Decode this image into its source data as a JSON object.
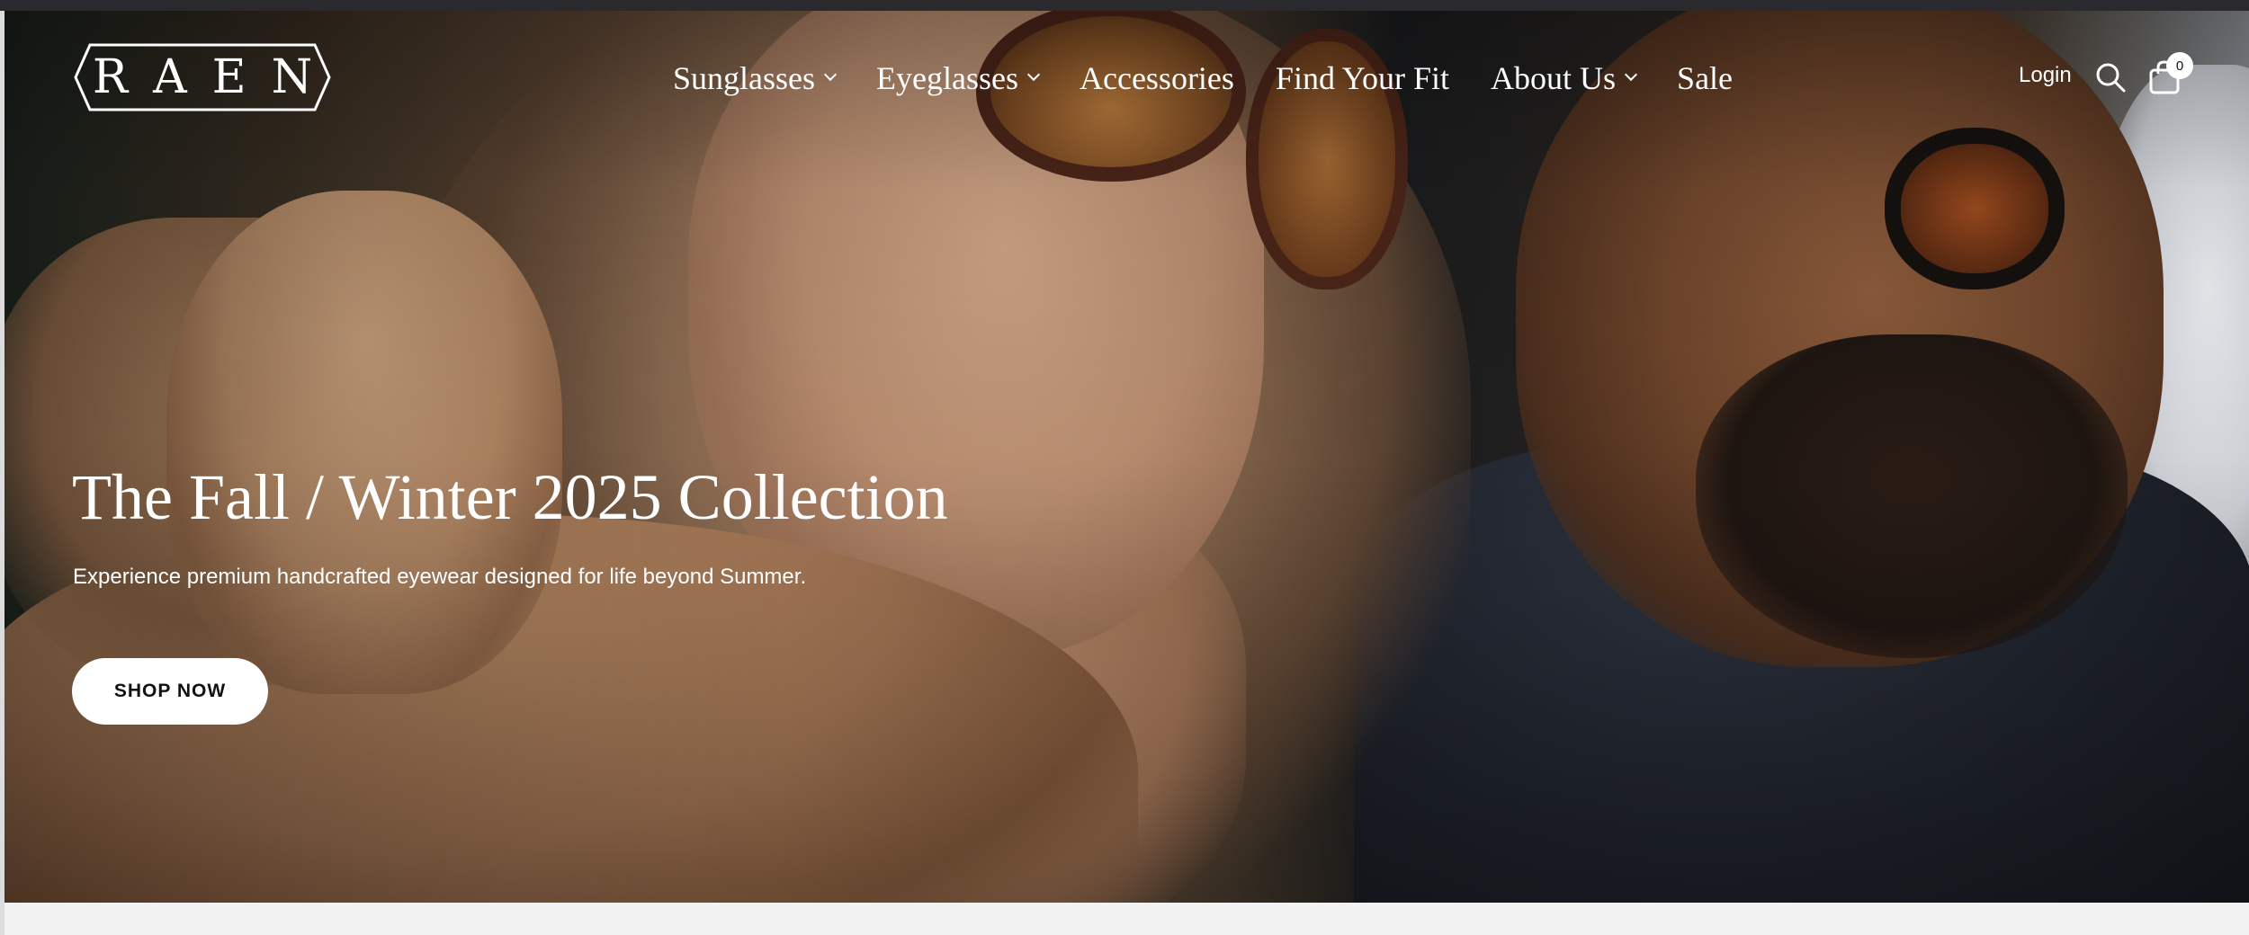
{
  "header": {
    "logo_text": "RAEN",
    "nav": [
      {
        "label": "Sunglasses",
        "has_dropdown": true
      },
      {
        "label": "Eyeglasses",
        "has_dropdown": true
      },
      {
        "label": "Accessories",
        "has_dropdown": false
      },
      {
        "label": "Find Your Fit",
        "has_dropdown": false
      },
      {
        "label": "About Us",
        "has_dropdown": true
      },
      {
        "label": "Sale",
        "has_dropdown": false
      }
    ],
    "login_label": "Login",
    "search_icon": "search-icon",
    "cart_icon": "shopping-bag-icon",
    "cart_count": "0"
  },
  "hero": {
    "title": "The Fall / Winter 2025 Collection",
    "subtitle": "Experience premium handcrafted eyewear designed for life beyond Summer.",
    "cta_label": "SHOP NOW"
  },
  "colors": {
    "text_on_hero": "#ffffff",
    "cta_background": "#ffffff",
    "cta_text": "#111111",
    "page_background": "#f3f3f3"
  }
}
